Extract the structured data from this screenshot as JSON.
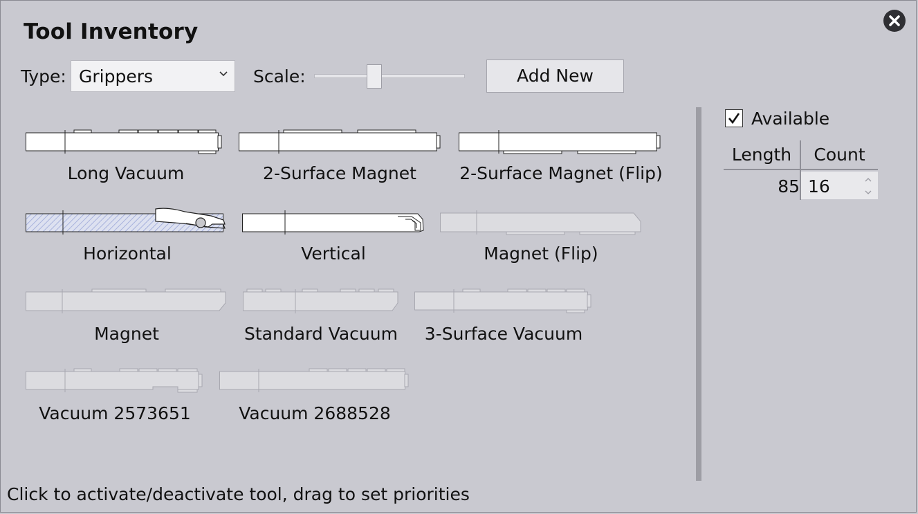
{
  "window": {
    "title": "Tool Inventory"
  },
  "toolbar": {
    "type_label": "Type:",
    "type_value": "Grippers",
    "scale_label": "Scale:",
    "scale_value": 0.4,
    "add_button": "Add New"
  },
  "tools": [
    {
      "name": "Long Vacuum",
      "active": true
    },
    {
      "name": "2-Surface Magnet",
      "active": true
    },
    {
      "name": "2-Surface Magnet (Flip)",
      "active": true
    },
    {
      "name": "Horizontal",
      "active": true,
      "selected": true
    },
    {
      "name": "Vertical",
      "active": true
    },
    {
      "name": "Magnet (Flip)",
      "active": false
    },
    {
      "name": "Magnet",
      "active": false
    },
    {
      "name": "Standard Vacuum",
      "active": false
    },
    {
      "name": "3-Surface Vacuum",
      "active": false
    },
    {
      "name": "Vacuum 2573651",
      "active": false
    },
    {
      "name": "Vacuum 2688528",
      "active": false
    }
  ],
  "details": {
    "available_label": "Available",
    "available_checked": true,
    "col_length": "Length",
    "col_count": "Count",
    "rows": [
      {
        "length": "85",
        "count": "16"
      }
    ]
  },
  "status": "Click to activate/deactivate tool, drag to set priorities",
  "colors": {
    "background": "#c9c9d0",
    "active_fill": "#ffffff",
    "inactive_fill": "#dcdce0",
    "inactive_stroke": "#a8a8b0",
    "selected_hatch": "#9aa6d8"
  }
}
